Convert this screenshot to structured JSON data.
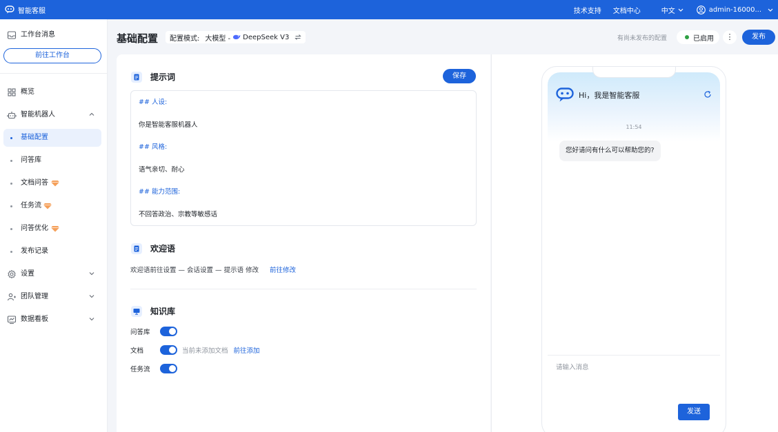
{
  "topbar": {
    "app_name": "智能客服",
    "links": [
      "技术支持",
      "文档中心"
    ],
    "language": "中文",
    "user": "admin-16000..."
  },
  "sidebar": {
    "workbench_msg": "工作台消息",
    "go_workbench": "前往工作台",
    "overview": "概览",
    "robot": "智能机器人",
    "robot_items": [
      {
        "label": "基础配置",
        "active": true,
        "premium": false
      },
      {
        "label": "问答库",
        "active": false,
        "premium": false
      },
      {
        "label": "文档问答",
        "active": false,
        "premium": true
      },
      {
        "label": "任务流",
        "active": false,
        "premium": true
      },
      {
        "label": "问答优化",
        "active": false,
        "premium": true
      },
      {
        "label": "发布记录",
        "active": false,
        "premium": false
      }
    ],
    "settings": "设置",
    "team": "团队管理",
    "dashboard": "数据看板"
  },
  "header": {
    "title": "基础配置",
    "mode_label": "配置模式:",
    "mode_value": "大模型 -",
    "model_name": "DeepSeek V3",
    "unpublished_note": "有尚未发布的配置",
    "status": "已启用",
    "more": "⋮",
    "publish": "发布"
  },
  "prompt": {
    "title": "提示词",
    "save": "保存",
    "lines": [
      {
        "text": "## 人设:",
        "heading": true
      },
      {
        "text": "你是智能客服机器人",
        "heading": false
      },
      {
        "text": "## 风格:",
        "heading": true
      },
      {
        "text": "语气亲切、耐心",
        "heading": false
      },
      {
        "text": "## 能力范围:",
        "heading": true
      },
      {
        "text": "不回答政治、宗教等敏感话",
        "heading": false
      }
    ]
  },
  "welcome": {
    "title": "欢迎语",
    "text": "欢迎语前往设置 — 会话设置 — 提示语 修改",
    "link": "前往修改"
  },
  "knowledge": {
    "title": "知识库",
    "rows": [
      {
        "label": "问答库",
        "on": true
      },
      {
        "label": "文档",
        "on": true,
        "note": "当前未添加文档",
        "link": "前往添加"
      },
      {
        "label": "任务流",
        "on": true
      }
    ]
  },
  "preview": {
    "greeting": "Hi，我是智能客服",
    "time": "11:54",
    "message": "您好请问有什么可以帮助您的?",
    "input_placeholder": "请输入消息",
    "send": "发送"
  },
  "colors": {
    "primary": "#1d63db",
    "active_bg": "#eaf1fd",
    "status_green": "#2ea043",
    "premium_orange": "#f5a05a"
  }
}
